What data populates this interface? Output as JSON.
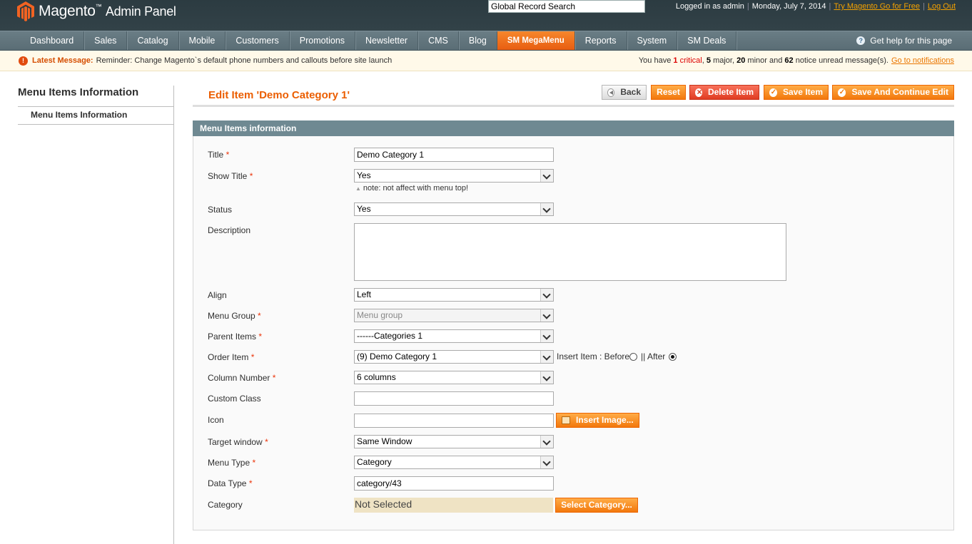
{
  "header": {
    "logo_text": "Magento",
    "logo_sub": "Admin Panel",
    "search_value": "Global Record Search",
    "logged_in": "Logged in as admin",
    "date": "Monday, July 7, 2014",
    "try_link": "Try Magento Go for Free",
    "logout": "Log Out"
  },
  "nav": {
    "items": [
      "Dashboard",
      "Sales",
      "Catalog",
      "Mobile",
      "Customers",
      "Promotions",
      "Newsletter",
      "CMS",
      "Blog",
      "SM MegaMenu",
      "Reports",
      "System",
      "SM Deals"
    ],
    "active": "SM MegaMenu",
    "help": "Get help for this page"
  },
  "message": {
    "title": "Latest Message:",
    "text": "Reminder: Change Magento`s default phone numbers and callouts before site launch",
    "prefix": "You have",
    "critical_count": "1",
    "critical_label": "critical",
    "major_count": "5",
    "major_label": "major,",
    "minor_count": "20",
    "minor_label": "minor and",
    "notice_count": "62",
    "notice_label": "notice unread message(s).",
    "link": "Go to notifications"
  },
  "sidebar": {
    "title": "Menu Items Information",
    "item": "Menu Items Information"
  },
  "page": {
    "title": "Edit Item 'Demo Category 1'",
    "buttons": {
      "back": "Back",
      "reset": "Reset",
      "delete": "Delete Item",
      "save": "Save Item",
      "save_continue": "Save And Continue Edit"
    }
  },
  "form": {
    "section_title": "Menu Items information",
    "required_mark": "*",
    "title": {
      "label": "Title",
      "value": "Demo Category 1"
    },
    "show_title": {
      "label": "Show Title",
      "value": "Yes",
      "note": "note: not affect with menu top!"
    },
    "status": {
      "label": "Status",
      "value": "Yes"
    },
    "description": {
      "label": "Description",
      "value": ""
    },
    "align": {
      "label": "Align",
      "value": "Left"
    },
    "menu_group": {
      "label": "Menu Group",
      "value": "Menu group"
    },
    "parent_items": {
      "label": "Parent Items",
      "value": "------Categories 1"
    },
    "order_item": {
      "label": "Order Item",
      "value": "(9) Demo Category 1",
      "insert_label": "Insert Item : Before",
      "sep": "|| After",
      "selected": "After"
    },
    "column_number": {
      "label": "Column Number",
      "value": "6 columns"
    },
    "custom_class": {
      "label": "Custom Class",
      "value": ""
    },
    "icon": {
      "label": "Icon",
      "value": "",
      "button": "Insert Image..."
    },
    "target_window": {
      "label": "Target window",
      "value": "Same Window"
    },
    "menu_type": {
      "label": "Menu Type",
      "value": "Category"
    },
    "data_type": {
      "label": "Data Type",
      "value": "category/43"
    },
    "category": {
      "label": "Category",
      "value": "Not Selected",
      "button": "Select Category..."
    }
  }
}
